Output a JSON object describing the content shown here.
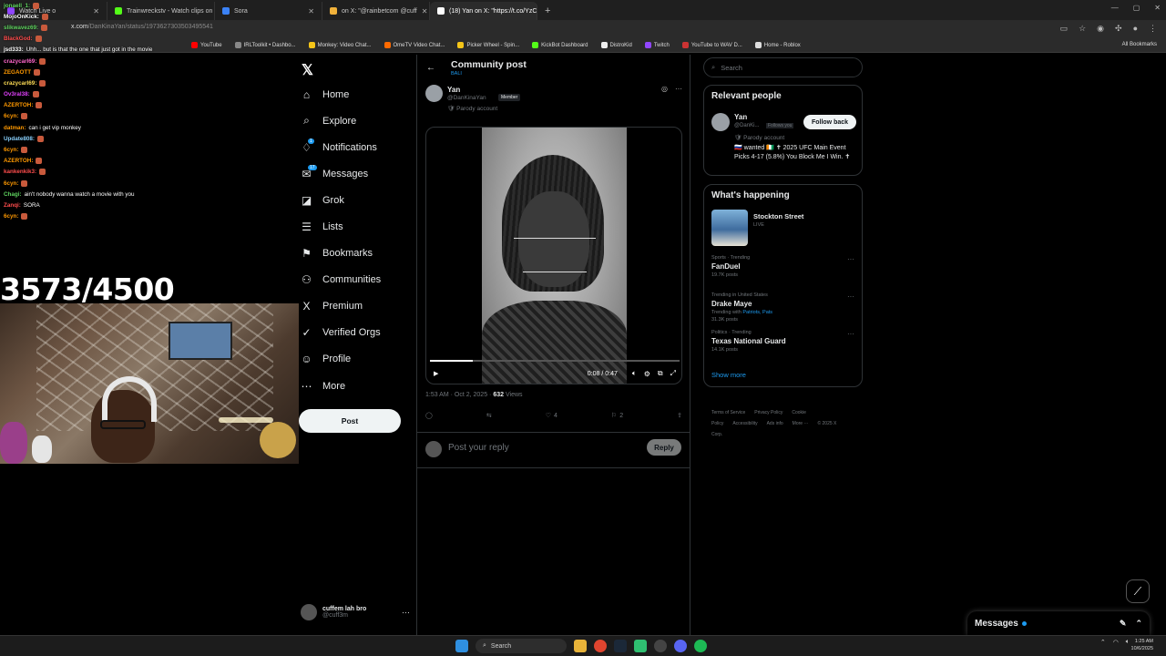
{
  "browser": {
    "tabs": [
      {
        "label": "Watch Live o",
        "color": "#9146ff",
        "active": false
      },
      {
        "label": "Trainwreckstv - Watch clips on",
        "color": "#53fc18",
        "active": false
      },
      {
        "label": "Sora",
        "color": "#3b82f6",
        "active": false
      },
      {
        "label": "on X: \"@rainbetcom @cuff",
        "color": "#f0b13a",
        "active": false
      },
      {
        "label": "(18) Yan on X: \"https://t.co/YzC",
        "color": "#ffffff",
        "active": true
      }
    ],
    "url_host": "x.com",
    "url_path": "/DanKinaYan/status/1973627303503495541",
    "bookmarks": [
      {
        "label": "YouTube",
        "color": "#ff0000"
      },
      {
        "label": "IRLToolkit • Dashbo...",
        "color": "#888888"
      },
      {
        "label": "Monkey: Video Chat...",
        "color": "#f5c518"
      },
      {
        "label": "OmeTV Video Chat...",
        "color": "#ff6a00"
      },
      {
        "label": "Picker Wheel - Spin...",
        "color": "#f5c518"
      },
      {
        "label": "KickBot Dashboard",
        "color": "#53fc18"
      },
      {
        "label": "DistroKid",
        "color": "#eeeeee"
      },
      {
        "label": "Twitch",
        "color": "#9146ff"
      },
      {
        "label": "YouTube to WAV D...",
        "color": "#cc3333"
      },
      {
        "label": "Home - Roblox",
        "color": "#dddddd"
      }
    ],
    "all_bookmarks": "All Bookmarks"
  },
  "chat": [
    {
      "user": "jonaell_1:",
      "color": "#5fd35f",
      "msg": ""
    },
    {
      "user": "MojoOnKick:",
      "color": "#ffffff",
      "msg": ""
    },
    {
      "user": "slikwavez69:",
      "color": "#5fd35f",
      "msg": ""
    },
    {
      "user": "BlackGod:",
      "color": "#ff4d4d",
      "msg": ""
    },
    {
      "user": "jsd333:",
      "color": "#ffffff",
      "msg": "Uhh... but is that the one that just got in the movie"
    },
    {
      "user": "crazycarl69:",
      "color": "#ff66cc",
      "msg": ""
    },
    {
      "user": "ZEGAOTT",
      "color": "#ff9900",
      "msg": ""
    },
    {
      "user": "crazycarl69:",
      "color": "#ffdd55",
      "msg": ""
    },
    {
      "user": "Ov3ral38:",
      "color": "#e040fb",
      "msg": ""
    },
    {
      "user": "AZERTOH:",
      "color": "#ff9900",
      "msg": ""
    },
    {
      "user": "6cyn:",
      "color": "#ff9900",
      "msg": ""
    },
    {
      "user": "datman:",
      "color": "#ff9900",
      "msg": "can i get vip monkey"
    },
    {
      "user": "Update808:",
      "color": "#87cefa",
      "msg": ""
    },
    {
      "user": "6cyn:",
      "color": "#ff9900",
      "msg": ""
    },
    {
      "user": "AZERTOH:",
      "color": "#ff9900",
      "msg": ""
    },
    {
      "user": "kankenkik3:",
      "color": "#ff4d4d",
      "msg": ""
    },
    {
      "user": "6cyn:",
      "color": "#ff9900",
      "msg": ""
    },
    {
      "user": "Chagi:",
      "color": "#5fd35f",
      "msg": "ain't nobody wanna watch a movie with you"
    },
    {
      "user": "Zanqi:",
      "color": "#ff4d4d",
      "msg": "SORA"
    },
    {
      "user": "6cyn:",
      "color": "#ff9900",
      "msg": ""
    }
  ],
  "counter": "3573/4500",
  "nav": {
    "items": [
      {
        "label": "Home",
        "icon": "⌂",
        "name": "home",
        "badge": ""
      },
      {
        "label": "Explore",
        "icon": "⌕",
        "name": "explore",
        "badge": ""
      },
      {
        "label": "Notifications",
        "icon": "♢",
        "name": "notifications",
        "badge": "1"
      },
      {
        "label": "Messages",
        "icon": "✉",
        "name": "messages",
        "badge": "17"
      },
      {
        "label": "Grok",
        "icon": "◪",
        "name": "grok",
        "badge": ""
      },
      {
        "label": "Lists",
        "icon": "☰",
        "name": "lists",
        "badge": ""
      },
      {
        "label": "Bookmarks",
        "icon": "⚑",
        "name": "bookmarks",
        "badge": ""
      },
      {
        "label": "Communities",
        "icon": "⚇",
        "name": "communities",
        "badge": ""
      },
      {
        "label": "Premium",
        "icon": "X",
        "name": "premium",
        "badge": ""
      },
      {
        "label": "Verified Orgs",
        "icon": "✓",
        "name": "verified-orgs",
        "badge": ""
      },
      {
        "label": "Profile",
        "icon": "☺",
        "name": "profile",
        "badge": ""
      },
      {
        "label": "More",
        "icon": "⋯",
        "name": "more",
        "badge": ""
      }
    ],
    "post_label": "Post",
    "account_name": "cuffem lah bro",
    "account_handle": "@cuff3m"
  },
  "main": {
    "title": "Community post",
    "subtitle": "BALI",
    "author_name": "Yan",
    "author_handle": "@DanKinaYan",
    "member_badge": "Member",
    "parody_label": "Parody account",
    "video_time": "0:08 / 0:47",
    "video_progress": 0.17,
    "timestamp": "1:53 AM · Oct 2, 2025 ·",
    "views_count": "632",
    "views_label": "Views",
    "likes": "4",
    "bookmarks": "2",
    "reply_placeholder": "Post your reply",
    "reply_button": "Reply"
  },
  "right": {
    "search_placeholder": "Search",
    "relevant_title": "Relevant people",
    "person_name": "Yan",
    "person_handle": "@DanKi...",
    "follows_you": "Follows you",
    "follow_back": "Follow back",
    "person_parody": "Parody account",
    "person_bio": "🇷🇺 wanted 🇨🇮 ✝ 2025 UFC Main Event Picks 4-17 (5.8%) You Block Me I Win. ✝",
    "happening_title": "What's happening",
    "live_title": "Stockton Street",
    "live_label": "LIVE",
    "trends": [
      {
        "category": "Sports · Trending",
        "name": "FanDuel",
        "with": "",
        "posts": "19.7K posts"
      },
      {
        "category": "Trending in United States",
        "name": "Drake Maye",
        "with": "Patriots, Pats",
        "posts": "31.3K posts"
      },
      {
        "category": "Politics · Trending",
        "name": "Texas National Guard",
        "with": "",
        "posts": "14.1K posts"
      }
    ],
    "trending_with_prefix": "Trending with",
    "show_more": "Show more",
    "footer": [
      "Terms of Service",
      "Privacy Policy",
      "Cookie Policy",
      "Accessibility",
      "Ads info",
      "More ···",
      "© 2025 X Corp."
    ],
    "messages_label": "Messages"
  },
  "taskbar": {
    "search_label": "Search",
    "time": "1:25 AM",
    "date": "10/6/2025"
  }
}
